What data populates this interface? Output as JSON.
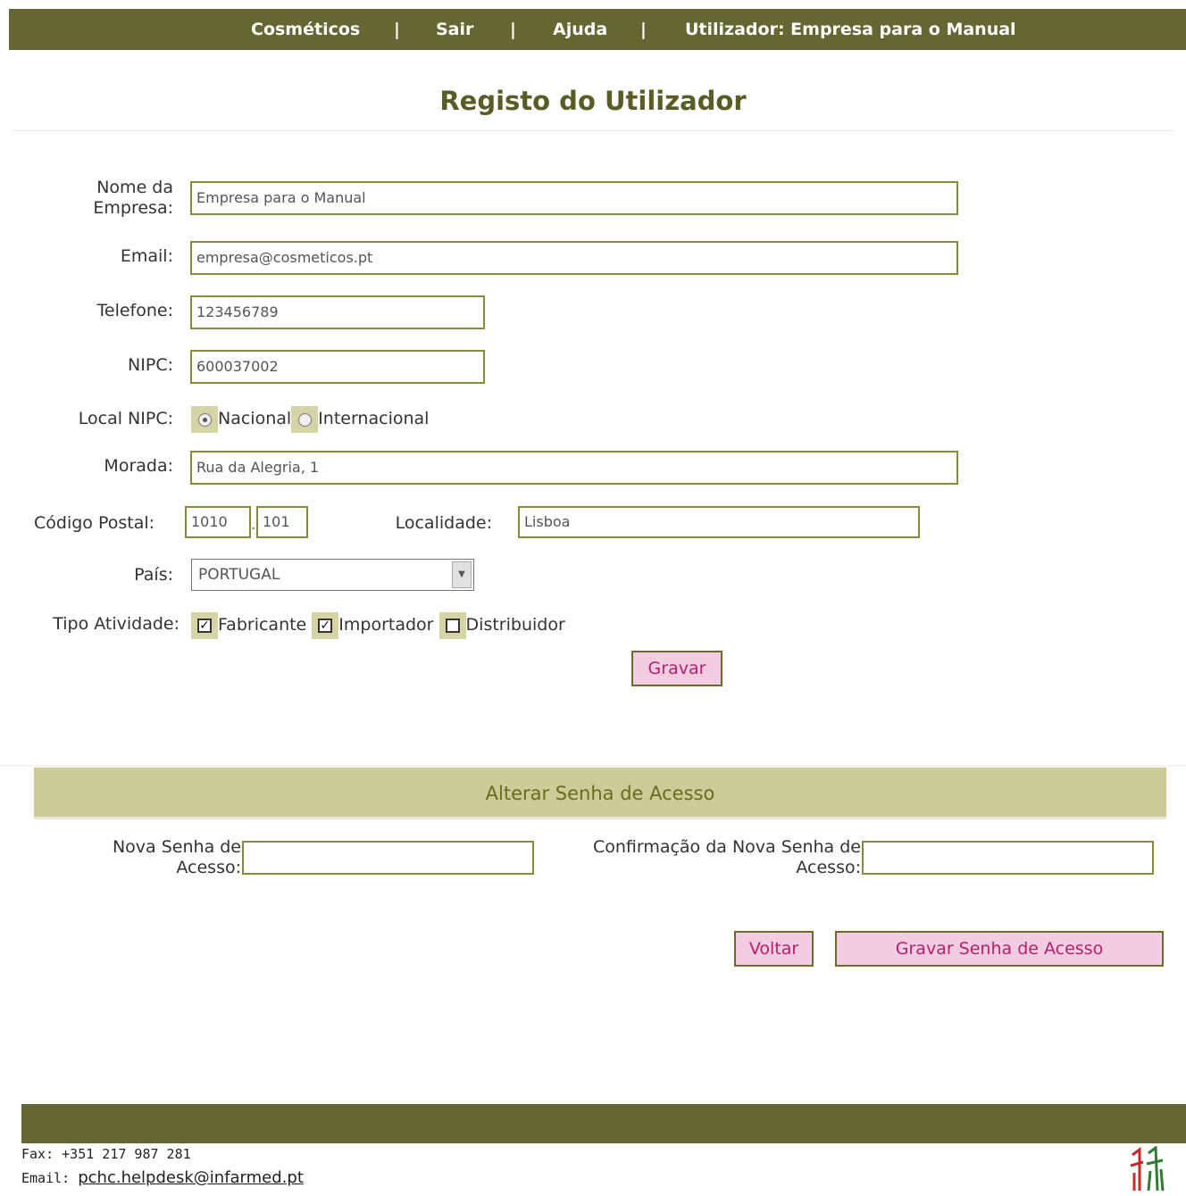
{
  "nav": {
    "items": [
      "Cosméticos",
      "Sair",
      "Ajuda",
      "Utilizador: Empresa para o Manual"
    ],
    "separator": "|"
  },
  "page_title": "Registo do Utilizador",
  "form": {
    "company_label": "Nome da Empresa:",
    "company_value": "Empresa para o Manual",
    "email_label": "Email:",
    "email_value": "empresa@cosmeticos.pt",
    "phone_label": "Telefone:",
    "phone_value": "123456789",
    "nipc_label": "NIPC:",
    "nipc_value": "600037002",
    "nipc_local_label": "Local NIPC:",
    "nipc_local_options": [
      "Nacional",
      "Internacional"
    ],
    "nipc_local_selected": "Nacional",
    "address_label": "Morada:",
    "address_value": "Rua da Alegria, 1",
    "postal_label": "Código Postal:",
    "postal_part1": "1010",
    "postal_dot": ".",
    "postal_part2": "101",
    "locality_label": "Localidade:",
    "locality_value": "Lisboa",
    "country_label": "País:",
    "country_value": "PORTUGAL",
    "activity_label": "Tipo Atividade:",
    "activity_options": [
      {
        "label": "Fabricante",
        "checked": true
      },
      {
        "label": "Importador",
        "checked": true
      },
      {
        "label": "Distribuidor",
        "checked": false
      }
    ],
    "save_button": "Gravar"
  },
  "password": {
    "header": "Alterar Senha de Acesso",
    "new_label": "Nova Senha de Acesso:",
    "confirm_label": "Confirmação da Nova Senha de Acesso:",
    "back_button": "Voltar",
    "save_button": "Gravar Senha de Acesso"
  },
  "footer": {
    "fax": "Fax: +351 217 987 281",
    "email_prefix": "Email:",
    "email_link": "pchc.helpdesk@infarmed.pt"
  },
  "colors": {
    "olive": "#666633",
    "title": "#5b5b25",
    "section_bg": "#cccc99",
    "button_bg": "#f2cde2",
    "button_text": "#b4206a"
  }
}
